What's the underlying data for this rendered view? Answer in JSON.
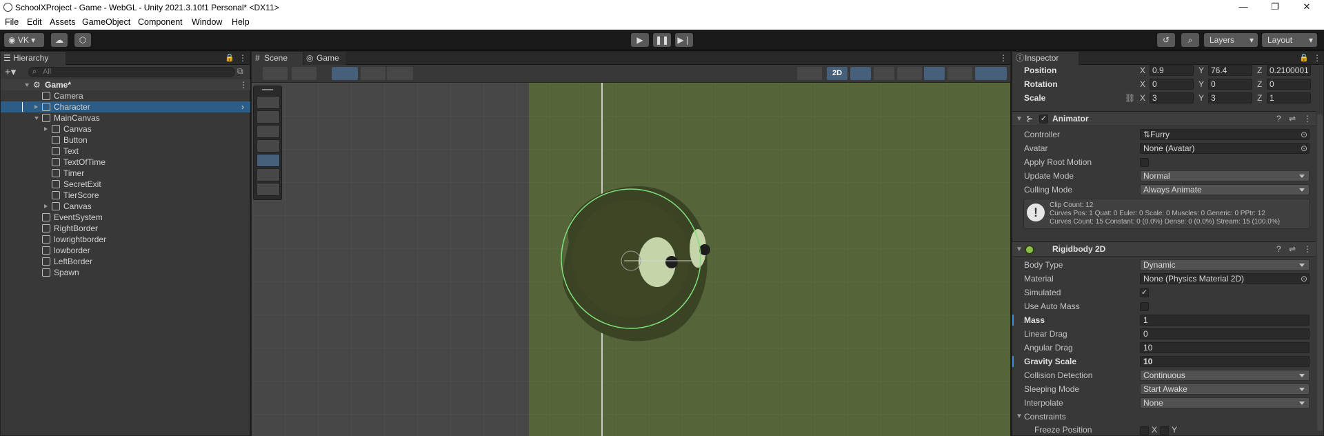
{
  "title_bar": {
    "title": "SchoolXProject - Game - WebGL - Unity 2021.3.10f1 Personal* <DX11>",
    "min": "—",
    "max": "❐",
    "close": "✕"
  },
  "menu": [
    "File",
    "Edit",
    "Assets",
    "GameObject",
    "Component",
    "Window",
    "Help"
  ],
  "toolbar": {
    "account": "VK",
    "layers": "Layers",
    "layout": "Layout"
  },
  "hierarchy": {
    "tab": "Hierarchy",
    "search_placeholder": "All",
    "scene": "Game*",
    "items": [
      {
        "label": "Camera",
        "depth": 1,
        "expander": "none"
      },
      {
        "label": "Character",
        "depth": 1,
        "expander": "collapsed",
        "selected": true
      },
      {
        "label": "MainCanvas",
        "depth": 1,
        "expander": "expanded"
      },
      {
        "label": "Canvas",
        "depth": 2,
        "expander": "collapsed"
      },
      {
        "label": "Button",
        "depth": 2,
        "expander": "none"
      },
      {
        "label": "Text",
        "depth": 2,
        "expander": "none"
      },
      {
        "label": "TextOfTime",
        "depth": 2,
        "expander": "none"
      },
      {
        "label": "Timer",
        "depth": 2,
        "expander": "none"
      },
      {
        "label": "SecretExit",
        "depth": 2,
        "expander": "none"
      },
      {
        "label": "TierScore",
        "depth": 2,
        "expander": "none"
      },
      {
        "label": "Canvas",
        "depth": 2,
        "expander": "collapsed"
      },
      {
        "label": "EventSystem",
        "depth": 1,
        "expander": "none"
      },
      {
        "label": "RightBorder",
        "depth": 1,
        "expander": "none"
      },
      {
        "label": "lowrightborder",
        "depth": 1,
        "expander": "none"
      },
      {
        "label": "lowborder",
        "depth": 1,
        "expander": "none"
      },
      {
        "label": "LeftBorder",
        "depth": 1,
        "expander": "none"
      },
      {
        "label": "Spawn",
        "depth": 1,
        "expander": "none"
      }
    ]
  },
  "scene_view": {
    "tabs": [
      "Scene",
      "Game"
    ],
    "mode_2d": "2D"
  },
  "inspector": {
    "tab": "Inspector",
    "transform": [
      {
        "label": "Position",
        "x": "0.9",
        "y": "76.4",
        "z": "0.2100001"
      },
      {
        "label": "Rotation",
        "x": "0",
        "y": "0",
        "z": "0"
      },
      {
        "label": "Scale",
        "x": "3",
        "y": "3",
        "z": "1"
      }
    ],
    "animator": {
      "name": "Animator",
      "controller_label": "Controller",
      "controller": "Furry",
      "avatar_label": "Avatar",
      "avatar": "None (Avatar)",
      "root_motion_label": "Apply Root Motion",
      "update_label": "Update Mode",
      "update": "Normal",
      "culling_label": "Culling Mode",
      "culling": "Always Animate",
      "info": [
        "Clip Count: 12",
        "Curves Pos: 1 Quat: 0 Euler: 0 Scale: 0 Muscles: 0 Generic: 0 PPtr: 12",
        "Curves Count: 15 Constant: 0 (0.0%) Dense: 0 (0.0%) Stream: 15 (100.0%)"
      ]
    },
    "rigidbody": {
      "name": "Rigidbody 2D",
      "body_type_label": "Body Type",
      "body_type": "Dynamic",
      "material_label": "Material",
      "material": "None (Physics Material 2D)",
      "simulated_label": "Simulated",
      "auto_mass_label": "Use Auto Mass",
      "mass_label": "Mass",
      "mass": "1",
      "linear_label": "Linear Drag",
      "linear": "0",
      "angular_label": "Angular Drag",
      "angular": "10",
      "gravity_label": "Gravity Scale",
      "gravity": "10",
      "collision_label": "Collision Detection",
      "collision": "Continuous",
      "sleeping_label": "Sleeping Mode",
      "sleeping": "Start Awake",
      "interp_label": "Interpolate",
      "interp": "None",
      "constraints_label": "Constraints",
      "freeze_label": "Freeze Position",
      "x": "X",
      "y": "Y"
    }
  },
  "colors": {
    "accent_selected": "#2c5d87",
    "game_bg": "#56643a",
    "collider": "#7fe07a"
  }
}
